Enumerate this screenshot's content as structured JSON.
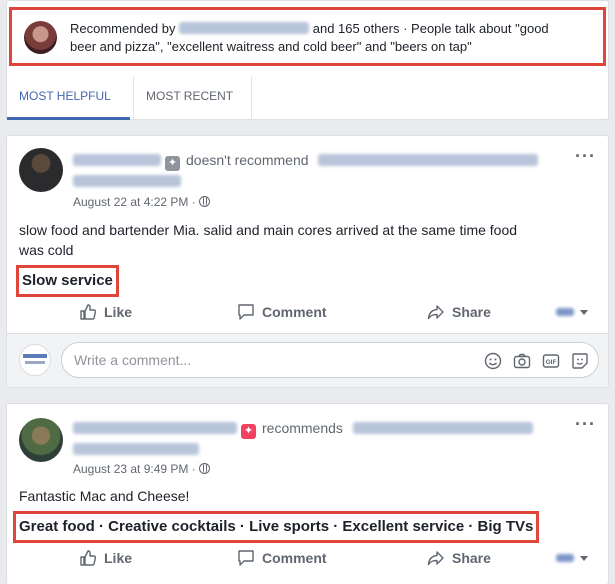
{
  "summary": {
    "prefix": "Recommended by",
    "suffix": "and 165 others · People talk about \"good",
    "line2": "beer and pizza\", \"excellent waitress and cold beer\" and \"beers on tap\""
  },
  "tabs": [
    {
      "label": "MOST HELPFUL"
    },
    {
      "label": "MOST RECENT"
    }
  ],
  "posts": [
    {
      "verb": "doesn't recommend",
      "date": "August 22 at 4:22 PM",
      "text_line1": "slow food and bartender Mia. salid and main cores arrived at the same time food",
      "text_line2": "was cold",
      "tags": "Slow service",
      "badge_color": "#90949c"
    },
    {
      "verb": "recommends",
      "date": "August 23 at 9:49 PM",
      "text_line1": "Fantastic Mac and Cheese!",
      "tags": "Great food · Creative cocktails · Live sports · Excellent service · Big TVs",
      "badge_color": "#f3425f"
    }
  ],
  "actions": {
    "like": "Like",
    "comment": "Comment",
    "share": "Share"
  },
  "comment_box": {
    "placeholder": "Write a comment..."
  },
  "colors": {
    "highlight": "#e0453c",
    "accent": "#4267b2"
  }
}
